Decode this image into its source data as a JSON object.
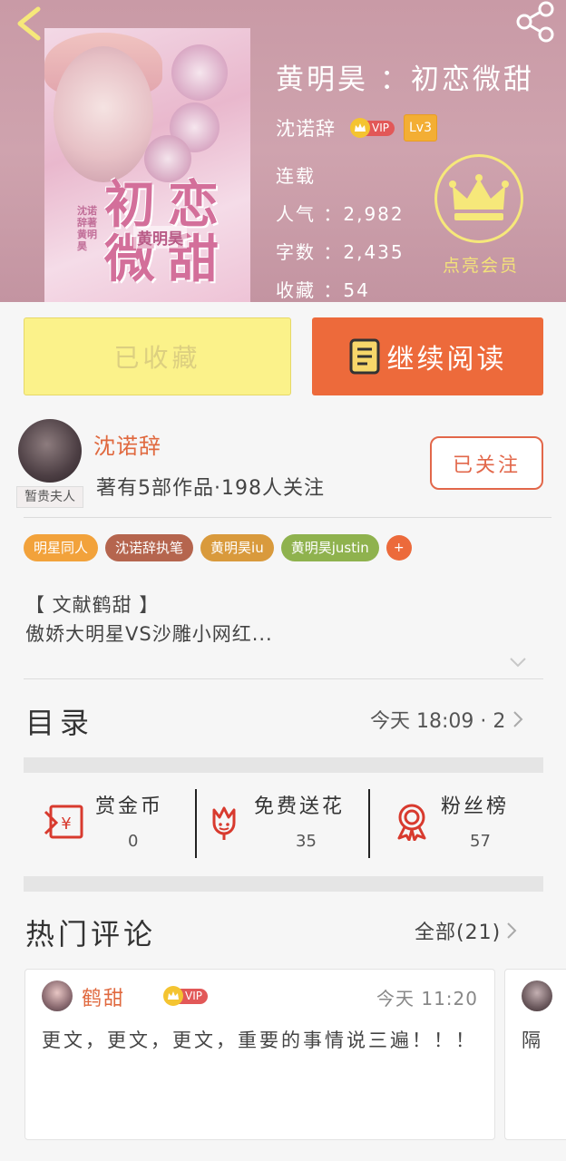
{
  "book": {
    "title": "黄明昊 ：初恋微甜",
    "author": "沈诺辞",
    "vip_label": "VIP",
    "level": "Lv3",
    "status": "连载",
    "popularity": "人气 ：2,982",
    "word_count": "字数 ：2,435",
    "favorites": "收藏 ：54",
    "member_label": "点亮会员"
  },
  "cover": {
    "title_chars": [
      "初",
      "恋",
      "微",
      "甜"
    ],
    "subtitle": "黄明昊",
    "side_text": "沈诺辞著黄明昊"
  },
  "actions": {
    "favorited_label": "已收藏",
    "continue_label": "继续阅读"
  },
  "author_card": {
    "name": "沈诺辞",
    "stats": "著有5部作品·198人关注",
    "avatar_tag": "暂贵夫人",
    "follow_label": "已关注"
  },
  "tags": [
    {
      "label": "明星同人",
      "color": "#f2a23b"
    },
    {
      "label": "沈诺辞执笔",
      "color": "#b5654e"
    },
    {
      "label": "黄明昊iu",
      "color": "#d99a3c"
    },
    {
      "label": "黄明昊justin",
      "color": "#8fb24e"
    }
  ],
  "tag_more": "+",
  "synopsis": {
    "line1": "【 文献鹤甜 】",
    "line2": "傲娇大明星VS沙雕小网红..."
  },
  "catalog": {
    "title": "目录",
    "latest": "今天 18:09 · 2"
  },
  "stats": [
    {
      "label": "赏金币",
      "value": "0",
      "icon": "red-envelope-icon"
    },
    {
      "label": "免费送花",
      "value": "35",
      "icon": "flower-icon"
    },
    {
      "label": "粉丝榜",
      "value": "57",
      "icon": "medal-icon"
    }
  ],
  "comments": {
    "title": "热门评论",
    "all_label": "全部(21)",
    "items": [
      {
        "user": "鹤甜",
        "vip": "VIP",
        "time": "今天 11:20",
        "text": "更文，更文，更文，重要的事情说三遍！！！"
      },
      {
        "text": "隔"
      }
    ]
  },
  "colors": {
    "accent": "#ed6a3b",
    "favorite_button": "#fbf28a",
    "header_bg": "#c99aa6"
  }
}
